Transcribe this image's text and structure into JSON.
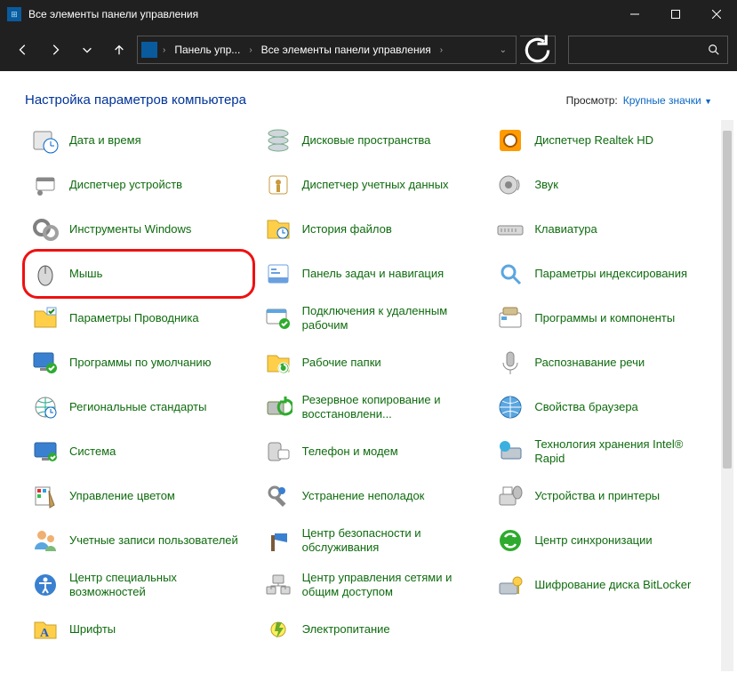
{
  "window": {
    "title": "Все элементы панели управления"
  },
  "address": {
    "crumb1": "Панель упр...",
    "crumb2": "Все элементы панели управления"
  },
  "header": {
    "heading": "Настройка параметров компьютера",
    "view_label": "Просмотр:",
    "view_value": "Крупные значки"
  },
  "items": [
    {
      "label": "Дата и время",
      "icon": "clock-calendar-icon",
      "hl": false
    },
    {
      "label": "Дисковые пространства",
      "icon": "disk-stack-icon",
      "hl": false
    },
    {
      "label": "Диспетчер Realtek HD",
      "icon": "realtek-icon",
      "hl": false
    },
    {
      "label": "Диспетчер устройств",
      "icon": "device-manager-icon",
      "hl": false
    },
    {
      "label": "Диспетчер учетных данных",
      "icon": "credential-manager-icon",
      "hl": false
    },
    {
      "label": "Звук",
      "icon": "speaker-icon",
      "hl": false
    },
    {
      "label": "Инструменты Windows",
      "icon": "windows-tools-icon",
      "hl": false
    },
    {
      "label": "История файлов",
      "icon": "file-history-icon",
      "hl": false
    },
    {
      "label": "Клавиатура",
      "icon": "keyboard-icon",
      "hl": false
    },
    {
      "label": "Мышь",
      "icon": "mouse-icon",
      "hl": true
    },
    {
      "label": "Панель задач и навигация",
      "icon": "taskbar-icon",
      "hl": false
    },
    {
      "label": "Параметры индексирования",
      "icon": "indexing-icon",
      "hl": false
    },
    {
      "label": "Параметры Проводника",
      "icon": "explorer-options-icon",
      "hl": false
    },
    {
      "label": "Подключения к удаленным рабочим",
      "icon": "remote-app-icon",
      "hl": false
    },
    {
      "label": "Программы и компоненты",
      "icon": "programs-features-icon",
      "hl": false
    },
    {
      "label": "Программы по умолчанию",
      "icon": "default-programs-icon",
      "hl": false
    },
    {
      "label": "Рабочие папки",
      "icon": "work-folders-icon",
      "hl": false
    },
    {
      "label": "Распознавание речи",
      "icon": "speech-icon",
      "hl": false
    },
    {
      "label": "Региональные стандарты",
      "icon": "region-icon",
      "hl": false
    },
    {
      "label": "Резервное копирование и восстановлени...",
      "icon": "backup-restore-icon",
      "hl": false
    },
    {
      "label": "Свойства браузера",
      "icon": "internet-options-icon",
      "hl": false
    },
    {
      "label": "Система",
      "icon": "system-icon",
      "hl": false
    },
    {
      "label": "Телефон и модем",
      "icon": "phone-modem-icon",
      "hl": false
    },
    {
      "label": "Технология хранения Intel® Rapid",
      "icon": "intel-rst-icon",
      "hl": false
    },
    {
      "label": "Управление цветом",
      "icon": "color-management-icon",
      "hl": false
    },
    {
      "label": "Устранение неполадок",
      "icon": "troubleshoot-icon",
      "hl": false
    },
    {
      "label": "Устройства и принтеры",
      "icon": "devices-printers-icon",
      "hl": false
    },
    {
      "label": "Учетные записи пользователей",
      "icon": "user-accounts-icon",
      "hl": false
    },
    {
      "label": "Центр безопасности и обслуживания",
      "icon": "security-maintenance-icon",
      "hl": false
    },
    {
      "label": "Центр синхронизации",
      "icon": "sync-center-icon",
      "hl": false
    },
    {
      "label": "Центр специальных возможностей",
      "icon": "ease-of-access-icon",
      "hl": false
    },
    {
      "label": "Центр управления сетями и общим доступом",
      "icon": "network-sharing-icon",
      "hl": false
    },
    {
      "label": "Шифрование диска BitLocker",
      "icon": "bitlocker-icon",
      "hl": false
    },
    {
      "label": "Шрифты",
      "icon": "fonts-icon",
      "hl": false
    },
    {
      "label": "Электропитание",
      "icon": "power-options-icon",
      "hl": false
    }
  ]
}
